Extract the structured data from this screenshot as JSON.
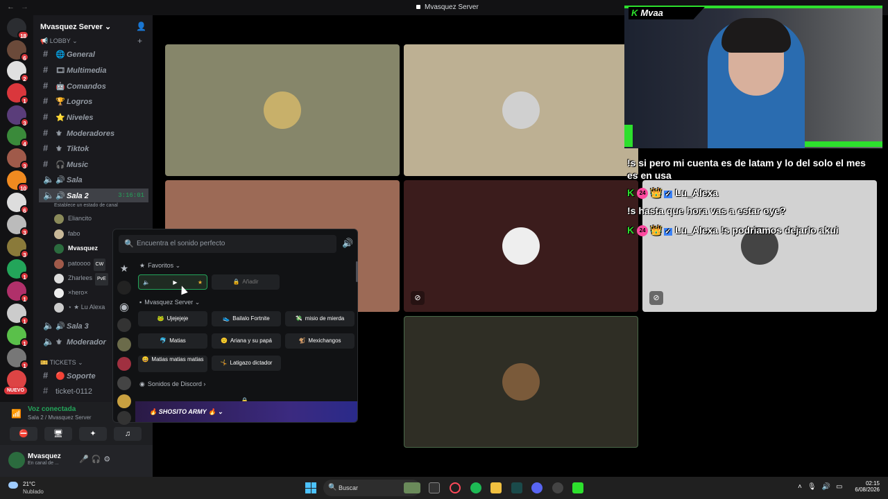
{
  "window": {
    "title": "Mvasquez Server"
  },
  "rail": {
    "badges": [
      "18",
      "6",
      "2",
      "1",
      "3",
      "4",
      "3",
      "10",
      "6",
      "3",
      "3",
      "1",
      "1",
      "1",
      "1",
      "1"
    ],
    "new_label": "NUEVO"
  },
  "server": {
    "name": "Mvasquez Server"
  },
  "categories": {
    "lobby": "LOBBY",
    "tickets": "TICKETS"
  },
  "channels": [
    {
      "name": "General",
      "type": "text",
      "emoji": "🌐"
    },
    {
      "name": "Multimedia",
      "type": "text",
      "emoji": "🎞"
    },
    {
      "name": "Comandos",
      "type": "text",
      "emoji": "🤖"
    },
    {
      "name": "Logros",
      "type": "text",
      "emoji": "🏆"
    },
    {
      "name": "Niveles",
      "type": "text",
      "emoji": "⭐"
    },
    {
      "name": "Moderadores",
      "type": "text",
      "emoji": "⚜"
    },
    {
      "name": "Tiktok",
      "type": "text",
      "emoji": "⚜"
    },
    {
      "name": "Music",
      "type": "text",
      "emoji": "🎧"
    },
    {
      "name": "Sala",
      "type": "voice",
      "emoji": "🔊"
    },
    {
      "name": "Sala 2",
      "type": "voice",
      "emoji": "🔊",
      "time": "3:16:01",
      "active": true
    },
    {
      "name": "Sala 3",
      "type": "voice",
      "emoji": "🔊"
    },
    {
      "name": "Moderador",
      "type": "voice",
      "emoji": "⚜"
    }
  ],
  "channel_status": "Establece un estado de canal",
  "voice_users": [
    {
      "name": "Eliancito"
    },
    {
      "name": "fabo"
    },
    {
      "name": "Mvasquez",
      "bright": true
    },
    {
      "name": "patoooo",
      "tag": "CW"
    },
    {
      "name": "Zharlees",
      "tag": "PvE"
    },
    {
      "name": "×hero×"
    },
    {
      "name": "⋆ ★ Lu Alexa"
    }
  ],
  "ticket_channels": [
    {
      "name": "Soporte"
    },
    {
      "name": "ticket-0112"
    }
  ],
  "voice_connected": {
    "title": "Voz conectada",
    "subtitle": "Sala 2 / Mvasquez Server"
  },
  "user": {
    "name": "Mvasquez",
    "status": "En canal de ..."
  },
  "stream": {
    "name": "Mvaa"
  },
  "chat": [
    {
      "text": "!s si pero mi cuenta es de latam y lo del solo el mes es en usa"
    },
    {
      "user": "Lu_Alexa",
      "badge": "24",
      "text": "!s hasta que hora vas a estar oye?"
    },
    {
      "user": "Lu_Alexa",
      "badge": "24",
      "text": "!s podriamos dejarlo akui"
    }
  ],
  "soundboard": {
    "search_placeholder": "Encuentra el sonido perfecto",
    "favorites_label": "Favoritos",
    "fav_sounds": [
      {
        "label": "",
        "locked": false
      },
      {
        "label": "Añadir",
        "locked": true
      }
    ],
    "server_label": "Mvasquez Server",
    "sounds": [
      {
        "label": "Ujejejeje",
        "emoji": "🐸"
      },
      {
        "label": "Bailalo Fortnite",
        "emoji": "👟"
      },
      {
        "label": "misio de mierda",
        "emoji": "💸"
      },
      {
        "label": "Matias",
        "emoji": "🐬"
      },
      {
        "label": "Ariana y su papá",
        "emoji": "🙁"
      },
      {
        "label": "Mexichangos",
        "emoji": "🐒"
      },
      {
        "label": "Matias matias matias",
        "emoji": "😀"
      },
      {
        "label": "Latigazo dictador",
        "emoji": "🤸"
      }
    ],
    "discord_label": "Sonidos de Discord",
    "army_label": "SHOSITO ARMY"
  },
  "taskbar": {
    "temp": "21°C",
    "condition": "Nublado",
    "search": "Buscar",
    "time": "02:15",
    "date": "6/08/2026"
  },
  "colors": {
    "accent_green": "#23a55a",
    "stream_green": "#2de02d",
    "danger": "#da373c"
  }
}
